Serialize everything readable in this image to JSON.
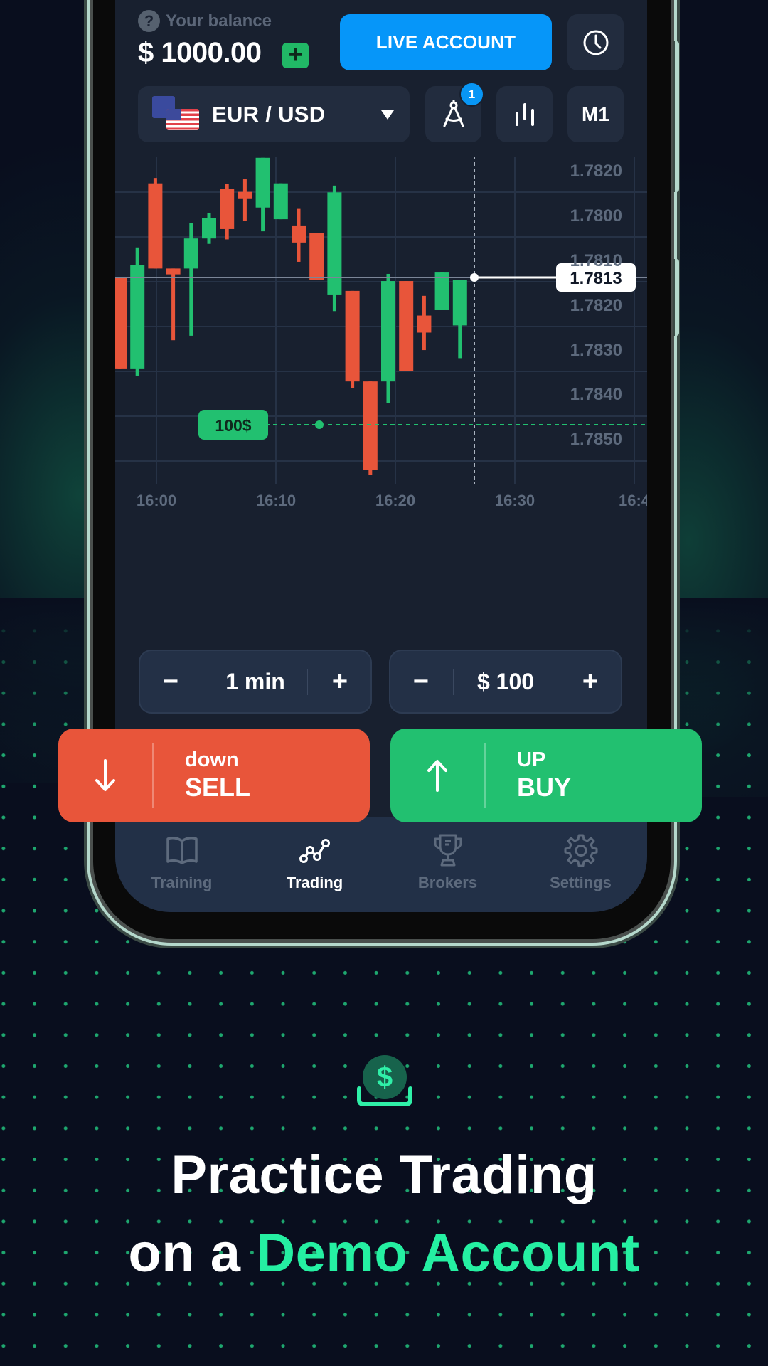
{
  "header": {
    "balance_label": "Your balance",
    "balance_value": "$ 1000.00",
    "help_icon": "question-circle-icon",
    "add_funds_icon": "plus-icon",
    "live_account_label": "LIVE ACCOUNT",
    "history_icon": "clock-icon"
  },
  "toolbar": {
    "pair_label": "EUR / USD",
    "pair_icon": "eu-us-flags-icon",
    "drawing_tool_icon": "compass-icon",
    "drawing_tool_badge": "1",
    "indicators_icon": "candles-icon",
    "timeframe_label": "M1"
  },
  "chart_data": {
    "type": "candlestick",
    "title": "EUR / USD",
    "y_tick_labels": [
      "1.7820",
      "1.7800",
      "1.7810",
      "1.7820",
      "1.7830",
      "1.7840",
      "1.7850"
    ],
    "x_tick_labels": [
      "16:00",
      "16:10",
      "16:20",
      "16:30",
      "16:4"
    ],
    "current_price": "1.7813",
    "trade_marker_label": "100$",
    "grid": true,
    "candles": [
      {
        "o": 1.7813,
        "h": 1.7813,
        "l": 1.77927,
        "c": 1.77927,
        "dir": "down"
      },
      {
        "o": 1.77927,
        "h": 1.78197,
        "l": 1.77911,
        "c": 1.78157,
        "dir": "up"
      },
      {
        "o": 1.7834,
        "h": 1.78352,
        "l": 1.7815,
        "c": 1.7815,
        "dir": "down"
      },
      {
        "o": 1.7815,
        "h": 1.7815,
        "l": 1.7799,
        "c": 1.78137,
        "dir": "down"
      },
      {
        "o": 1.7815,
        "h": 1.78252,
        "l": 1.78,
        "c": 1.78217,
        "dir": "up"
      },
      {
        "o": 1.78217,
        "h": 1.78273,
        "l": 1.78205,
        "c": 1.78263,
        "dir": "up"
      },
      {
        "o": 1.78327,
        "h": 1.78338,
        "l": 1.78215,
        "c": 1.78238,
        "dir": "down"
      },
      {
        "o": 1.78321,
        "h": 1.78349,
        "l": 1.78256,
        "c": 1.78305,
        "dir": "down"
      },
      {
        "o": 1.78286,
        "h": 1.78397,
        "l": 1.78233,
        "c": 1.78397,
        "dir": "up"
      },
      {
        "o": 1.7826,
        "h": 1.7834,
        "l": 1.7826,
        "c": 1.7834,
        "dir": "up"
      },
      {
        "o": 1.78246,
        "h": 1.78283,
        "l": 1.78165,
        "c": 1.78208,
        "dir": "down"
      },
      {
        "o": 1.78229,
        "h": 1.78229,
        "l": 1.78125,
        "c": 1.78125,
        "dir": "down"
      },
      {
        "o": 1.78092,
        "h": 1.78335,
        "l": 1.78055,
        "c": 1.7832,
        "dir": "up"
      },
      {
        "o": 1.781,
        "h": 1.781,
        "l": 1.77883,
        "c": 1.77898,
        "dir": "down"
      },
      {
        "o": 1.77898,
        "h": 1.77898,
        "l": 1.7769,
        "c": 1.777,
        "dir": "down"
      },
      {
        "o": 1.77898,
        "h": 1.78138,
        "l": 1.7785,
        "c": 1.78122,
        "dir": "up"
      },
      {
        "o": 1.78122,
        "h": 1.78122,
        "l": 1.77922,
        "c": 1.77922,
        "dir": "down"
      },
      {
        "o": 1.78045,
        "h": 1.78089,
        "l": 1.77968,
        "c": 1.78007,
        "dir": "down"
      },
      {
        "o": 1.78057,
        "h": 1.78141,
        "l": 1.78057,
        "c": 1.78141,
        "dir": "up"
      },
      {
        "o": 1.78023,
        "h": 1.78125,
        "l": 1.7795,
        "c": 1.78125,
        "dir": "up"
      }
    ],
    "colors": {
      "up": "#22c070",
      "down": "#e8553a"
    }
  },
  "controls": {
    "duration": {
      "minus": "−",
      "value": "1 min",
      "plus": "+"
    },
    "amount": {
      "minus": "−",
      "value": "$ 100",
      "plus": "+"
    }
  },
  "trade_buttons": {
    "sell": {
      "small": "down",
      "big": "SELL",
      "icon": "arrow-down-icon",
      "color": "#e8553a"
    },
    "buy": {
      "small": "UP",
      "big": "BUY",
      "icon": "arrow-up-icon",
      "color": "#22c070"
    }
  },
  "tabs": [
    {
      "label": "Training",
      "icon": "book-icon",
      "active": false
    },
    {
      "label": "Trading",
      "icon": "chart-line-icon",
      "active": true
    },
    {
      "label": "Brokers",
      "icon": "trophy-icon",
      "active": false
    },
    {
      "label": "Settings",
      "icon": "gear-icon",
      "active": false
    }
  ],
  "promo": {
    "icon": "dollar-deposit-icon",
    "line1": "Practice Trading",
    "line2_prefix": "on a ",
    "line2_accent": "Demo Account",
    "accent_color": "#25f0a2"
  }
}
